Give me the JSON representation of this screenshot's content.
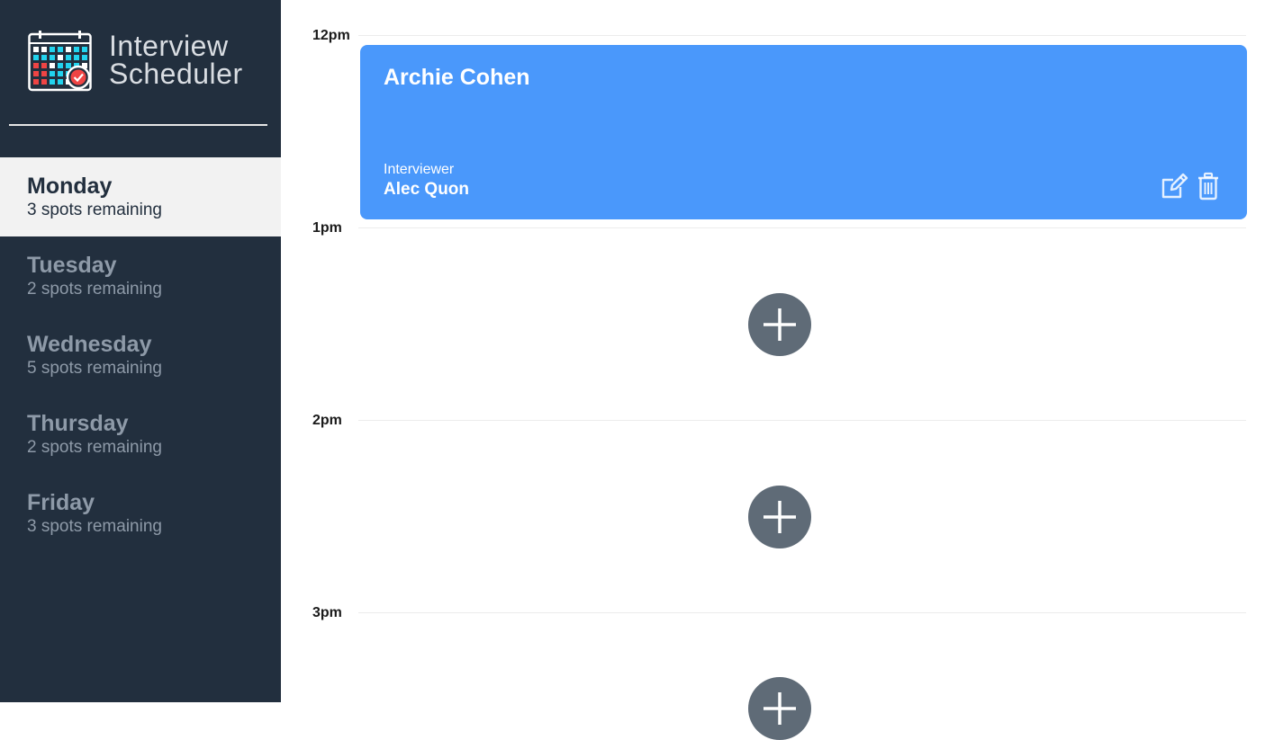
{
  "app": {
    "title_line1": "Interview",
    "title_line2": "Scheduler"
  },
  "sidebar": {
    "days": [
      {
        "name": "Monday",
        "spots": "3 spots remaining",
        "selected": true
      },
      {
        "name": "Tuesday",
        "spots": "2 spots remaining",
        "selected": false
      },
      {
        "name": "Wednesday",
        "spots": "5 spots remaining",
        "selected": false
      },
      {
        "name": "Thursday",
        "spots": "2 spots remaining",
        "selected": false
      },
      {
        "name": "Friday",
        "spots": "3 spots remaining",
        "selected": false
      }
    ]
  },
  "schedule": {
    "times": [
      "12pm",
      "1pm",
      "2pm",
      "3pm"
    ],
    "appointment": {
      "student": "Archie Cohen",
      "interviewer_label": "Interviewer",
      "interviewer": "Alec Quon"
    }
  },
  "icons": {
    "logo": "calendar-check-icon",
    "edit": "edit-icon",
    "delete": "trash-icon",
    "add": "add-circle-icon"
  },
  "colors": {
    "sidebar_bg": "#222f3e",
    "selected_bg": "#f2f2f2",
    "appointment_bg": "#4a98fb",
    "add_button_bg": "#5f6b77"
  }
}
